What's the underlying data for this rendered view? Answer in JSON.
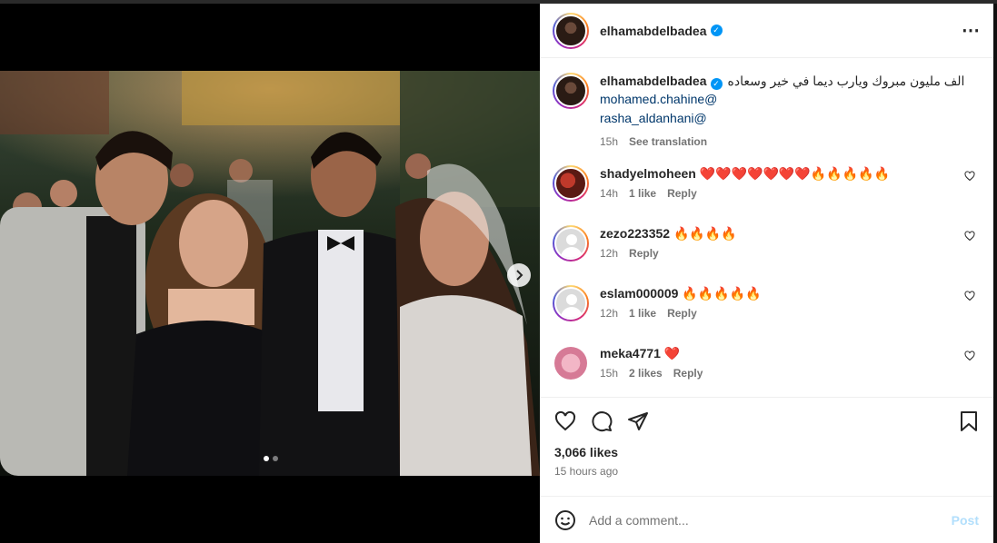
{
  "post": {
    "username": "elhamabdelbadea",
    "caption": "الف مليون مبروك ويارب ديما في خير وسعاده",
    "mentions": [
      "mohamed.chahine@",
      "rasha_aldanhani@"
    ],
    "caption_time": "15h",
    "see_translation": "See translation",
    "more_icon": "⋯",
    "verified_icon": "✓"
  },
  "comments": [
    {
      "username": "shadyelmoheen",
      "text": "❤️❤️❤️❤️❤️❤️❤️🔥🔥🔥🔥🔥",
      "time": "14h",
      "likes": "1 like",
      "reply": "Reply"
    },
    {
      "username": "zezo223352",
      "text": "🔥🔥🔥🔥",
      "time": "12h",
      "likes": "",
      "reply": "Reply"
    },
    {
      "username": "eslam000009",
      "text": "🔥🔥🔥🔥🔥",
      "time": "12h",
      "likes": "1 like",
      "reply": "Reply"
    },
    {
      "username": "meka4771",
      "text": "❤️",
      "time": "15h",
      "likes": "2 likes",
      "reply": "Reply"
    }
  ],
  "stats": {
    "likes": "3,066 likes",
    "posted": "15 hours ago"
  },
  "composer": {
    "placeholder": "Add a comment...",
    "post_label": "Post"
  },
  "carousel": {
    "total": 2,
    "active": 1
  },
  "icons": [
    "heart-icon",
    "comment-icon",
    "share-icon",
    "bookmark-icon",
    "emoji-icon",
    "chevron-right-icon"
  ]
}
